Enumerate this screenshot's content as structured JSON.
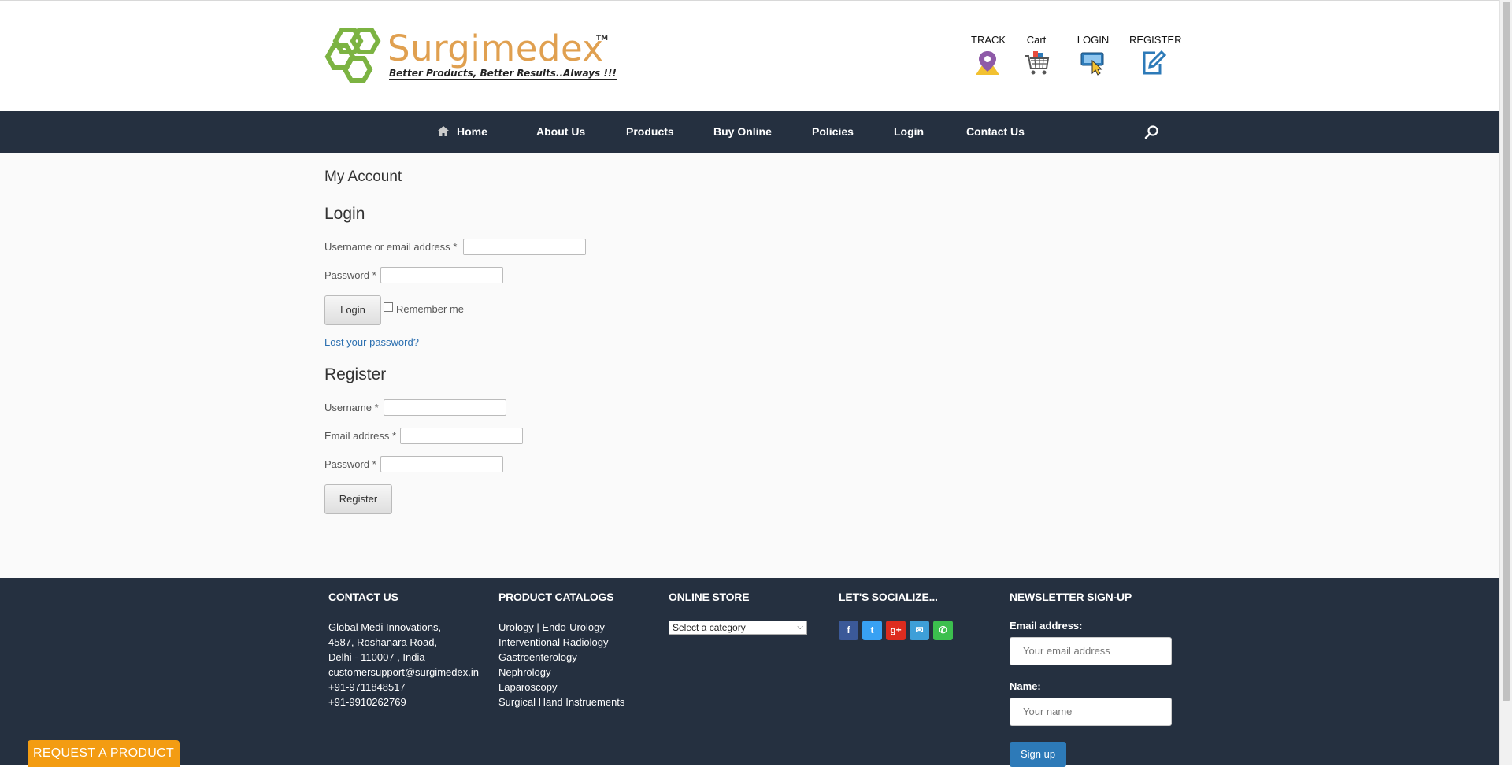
{
  "header": {
    "brand_name": "Surgimedex",
    "trademark": "TM",
    "tagline": "Better Products, Better Results..Always !!!",
    "links": [
      {
        "label": "TRACK",
        "icon": "location-pin-icon"
      },
      {
        "label": "Cart",
        "icon": "shopping-cart-icon"
      },
      {
        "label": "LOGIN",
        "icon": "sign-in-icon"
      },
      {
        "label": "REGISTER",
        "icon": "edit-icon"
      }
    ]
  },
  "nav": {
    "items": [
      "Home",
      "About Us",
      "Products",
      "Buy Online",
      "Policies",
      "Login",
      "Contact Us"
    ],
    "home_icon": "home-icon",
    "search_icon": "search-icon"
  },
  "account": {
    "title": "My Account",
    "login": {
      "heading": "Login",
      "username_label": "Username or email address",
      "password_label": "Password",
      "required_mark": "*",
      "button": "Login",
      "remember_label": "Remember me",
      "lost_password": "Lost your password?"
    },
    "register": {
      "heading": "Register",
      "username_label": "Username",
      "email_label": "Email address",
      "password_label": "Password",
      "required_mark": "*",
      "button": "Register"
    }
  },
  "footer": {
    "contact": {
      "title": "CONTACT US",
      "lines": [
        "Global Medi Innovations,",
        "4587,  Roshanara  Road,",
        "Delhi - 110007 ,  India",
        "customersupport@surgimedex.in",
        "+91-9711848517",
        "+91-9910262769"
      ]
    },
    "catalogs": {
      "title": "PRODUCT CATALOGS",
      "items": [
        "Urology | Endo-Urology",
        "Interventional Radiology",
        "Gastroenterology",
        "Nephrology",
        "Laparoscopy",
        "Surgical Hand Instruements"
      ]
    },
    "store": {
      "title": "ONLINE STORE",
      "select_value": "Select a category"
    },
    "social": {
      "title": "LET'S SOCIALIZE...",
      "icons": [
        {
          "name": "facebook-icon",
          "glyph": "f",
          "color": "#3b5998"
        },
        {
          "name": "twitter-icon",
          "glyph": "t",
          "color": "#38a1f3"
        },
        {
          "name": "google-plus-icon",
          "glyph": "g+",
          "color": "#dd2c1f"
        },
        {
          "name": "email-icon",
          "glyph": "✉",
          "color": "#3e9fd8"
        },
        {
          "name": "phone-icon",
          "glyph": "✆",
          "color": "#3cbf4e"
        }
      ]
    },
    "newsletter": {
      "title": "NEWSLETTER SIGN-UP",
      "email_label": "Email address:",
      "email_placeholder": "Your email address",
      "name_label": "Name:",
      "name_placeholder": "Your name",
      "button": "Sign up"
    }
  },
  "request_button": "REQUEST A PRODUCT",
  "colors": {
    "nav_bg": "#253040",
    "brand_orange": "#e0a050",
    "logo_green": "#7cb342",
    "link_blue": "#2b6fb0",
    "request_orange": "#f39c12"
  }
}
